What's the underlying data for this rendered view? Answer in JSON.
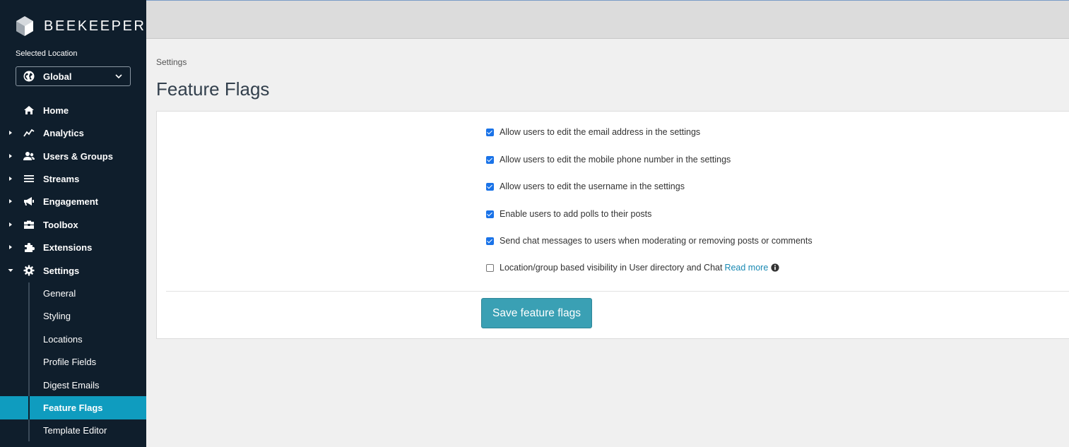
{
  "brand": {
    "name": "BEEKEEPER"
  },
  "location": {
    "label": "Selected Location",
    "value": "Global"
  },
  "nav": [
    {
      "label": "Home",
      "icon": "home-icon",
      "expandable": false
    },
    {
      "label": "Analytics",
      "icon": "analytics-icon",
      "expandable": true
    },
    {
      "label": "Users & Groups",
      "icon": "users-icon",
      "expandable": true
    },
    {
      "label": "Streams",
      "icon": "streams-icon",
      "expandable": true
    },
    {
      "label": "Engagement",
      "icon": "megaphone-icon",
      "expandable": true
    },
    {
      "label": "Toolbox",
      "icon": "toolbox-icon",
      "expandable": true
    },
    {
      "label": "Extensions",
      "icon": "puzzle-icon",
      "expandable": true
    },
    {
      "label": "Settings",
      "icon": "gear-icon",
      "expandable": true,
      "expanded": true
    }
  ],
  "settings_sub": [
    {
      "label": "General"
    },
    {
      "label": "Styling"
    },
    {
      "label": "Locations"
    },
    {
      "label": "Profile Fields"
    },
    {
      "label": "Digest Emails"
    },
    {
      "label": "Feature Flags",
      "active": true
    },
    {
      "label": "Template Editor"
    }
  ],
  "breadcrumb": "Settings",
  "page_title": "Feature Flags",
  "flags": [
    {
      "label": "Allow users to edit the email address in the settings",
      "checked": true
    },
    {
      "label": "Allow users to edit the mobile phone number in the settings",
      "checked": true
    },
    {
      "label": "Allow users to edit the username in the settings",
      "checked": true
    },
    {
      "label": "Enable users to add polls to their posts",
      "checked": true
    },
    {
      "label": "Send chat messages to users when moderating or removing posts or comments",
      "checked": true
    },
    {
      "label": "Location/group based visibility in User directory and Chat",
      "checked": false,
      "link": "Read more"
    }
  ],
  "save_button": "Save feature flags",
  "colors": {
    "sidebar": "#0f1e2c",
    "active": "#0f9cbf",
    "button": "#3aa0b4",
    "checkbox": "#1a73e8",
    "link": "#1989b3"
  }
}
